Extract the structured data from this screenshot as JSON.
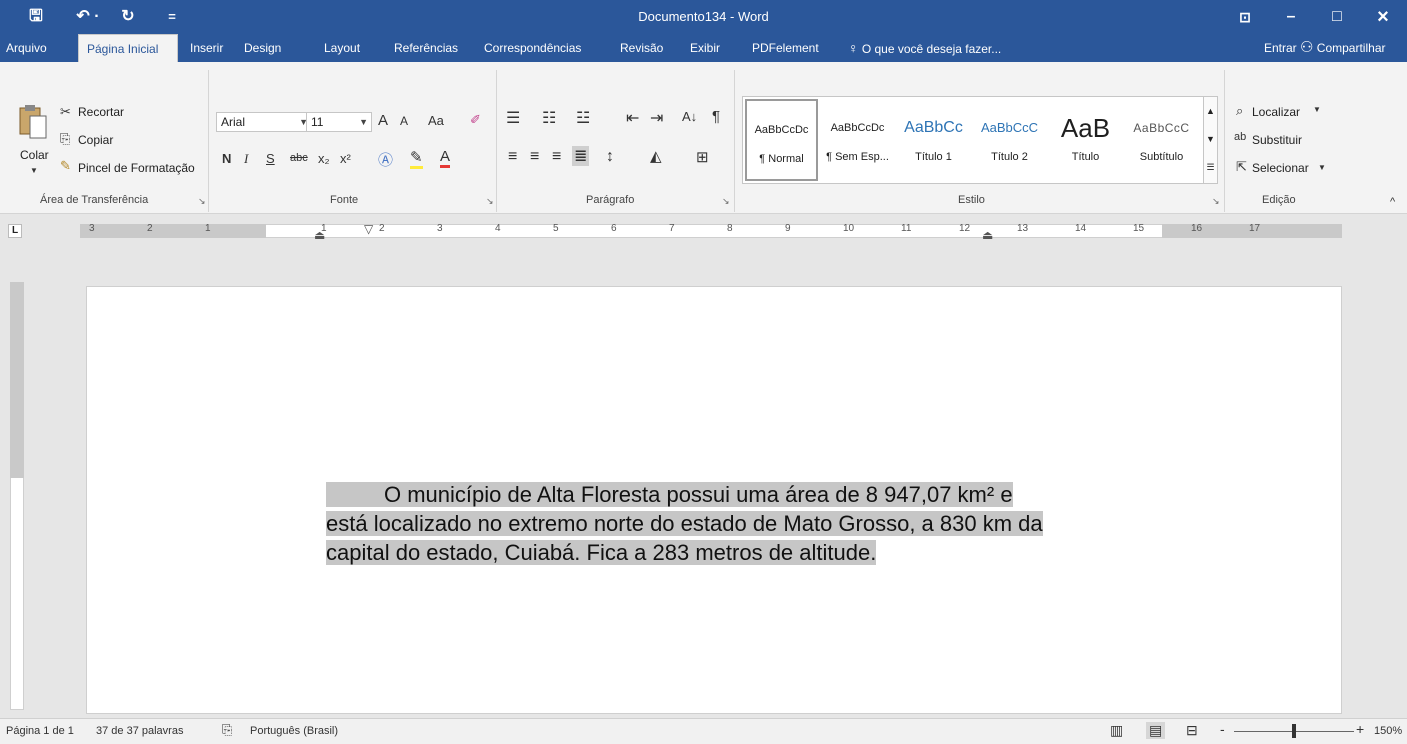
{
  "window": {
    "title": "Documento134 - Word",
    "qat_save": "🖫",
    "qat_undo": "↶ ·",
    "qat_redo": "↻",
    "qat_customize": "=",
    "options_icon": "⊡",
    "minimize": "–",
    "maximize": "□",
    "close": "×"
  },
  "tabs": [
    "Arquivo",
    "Página Inicial",
    "Inserir",
    "Design",
    "Layout",
    "Referências",
    "Correspondências",
    "Revisão",
    "Exibir",
    "PDFelement"
  ],
  "active_tab": "Página Inicial",
  "tell_me": "O que você deseja fazer...",
  "sign_in": "Entrar",
  "share": "Compartilhar",
  "clipboard": {
    "paste": "Colar",
    "cut": "Recortar",
    "copy": "Copiar",
    "format_painter": "Pincel de Formatação",
    "group": "Área de Transferência"
  },
  "font": {
    "name": "Arial",
    "size": "11",
    "grow": "A",
    "shrink": "A",
    "case": "Aa",
    "bold": "N",
    "italic": "I",
    "underline": "S",
    "strike": "abc",
    "subscript": "x₂",
    "superscript": "x²",
    "group": "Fonte"
  },
  "paragraph": {
    "group": "Parágrafo",
    "sort": "A↓",
    "pilcrow": "¶"
  },
  "styles": {
    "group": "Estilo",
    "items": [
      {
        "sample": "AaBbCcDc",
        "name": "¶ Normal"
      },
      {
        "sample": "AaBbCcDc",
        "name": "¶ Sem Esp..."
      },
      {
        "sample": "AaBbCc",
        "name": "Título 1"
      },
      {
        "sample": "AaBbCcC",
        "name": "Título 2"
      },
      {
        "sample": "AaB",
        "name": "Título"
      },
      {
        "sample": "AaBbCcC",
        "name": "Subtítulo"
      }
    ]
  },
  "editing": {
    "find": "Localizar",
    "replace": "Substituir",
    "select": "Selecionar",
    "group": "Edição"
  },
  "ruler": {
    "corner": "L",
    "numbers_left": [
      "3",
      "2",
      "1"
    ],
    "numbers_right": [
      "1",
      "2",
      "3",
      "4",
      "5",
      "6",
      "7",
      "8",
      "9",
      "10",
      "11",
      "12",
      "13",
      "14",
      "15",
      "16",
      "17"
    ]
  },
  "document": {
    "paragraph": "O município de Alta Floresta possui uma área de 8 947,07 km² e está localizado no extremo norte do estado de Mato Grosso, a 830 km da capital do estado, Cuiabá. Fica a 283 metros de altitude."
  },
  "status": {
    "page": "Página 1 de 1",
    "words": "37 de 37 palavras",
    "language": "Português (Brasil)",
    "zoom": "150%",
    "zoom_minus": "-",
    "zoom_plus": "+"
  }
}
